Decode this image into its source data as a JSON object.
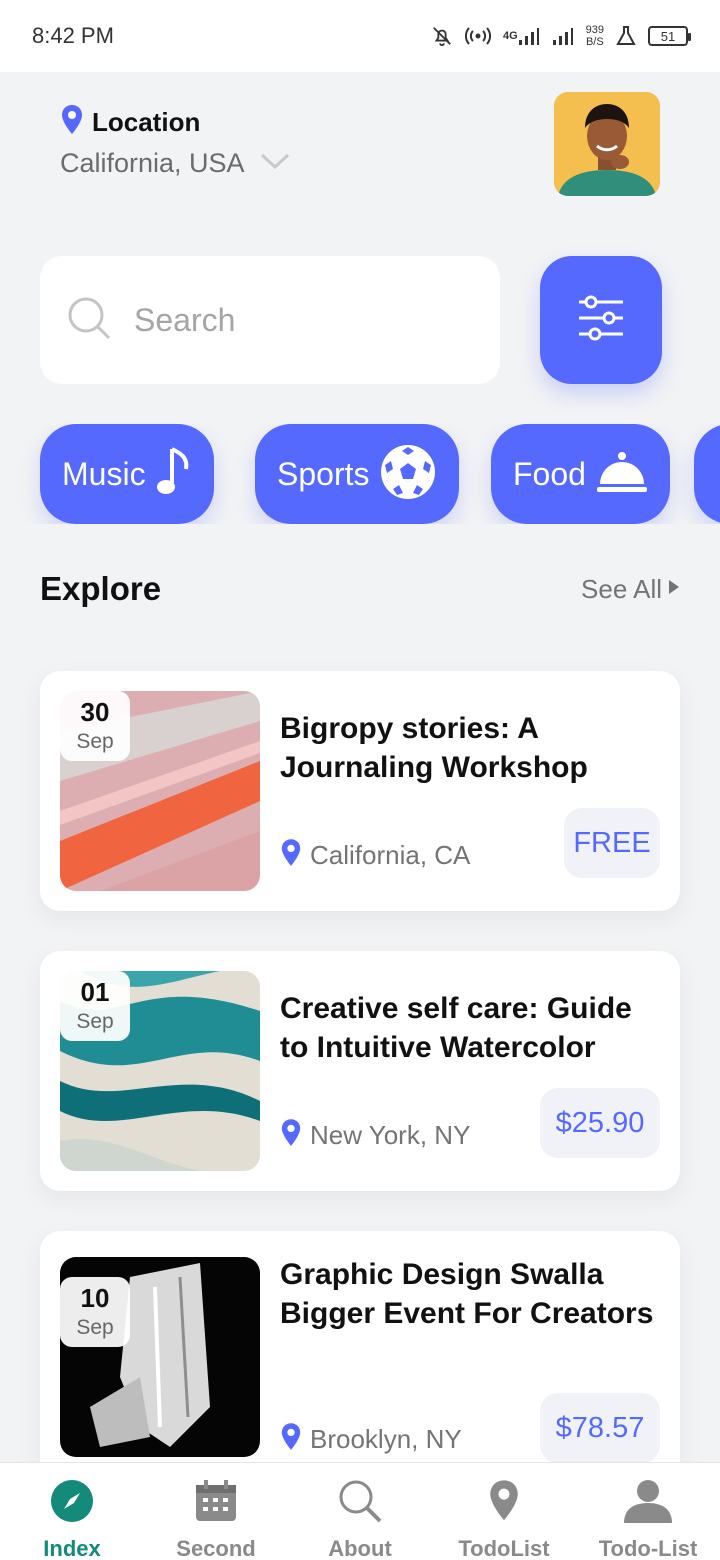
{
  "status_bar": {
    "time": "8:42 PM",
    "signal_label": "4G",
    "netspeed_value": "939",
    "netspeed_unit": "B/S",
    "battery": "51"
  },
  "header": {
    "location_label": "Location",
    "location_value": "California, USA"
  },
  "search": {
    "placeholder": "Search"
  },
  "categories": [
    {
      "label": "Music",
      "icon": "music-note-icon"
    },
    {
      "label": "Sports",
      "icon": "soccer-ball-icon"
    },
    {
      "label": "Food",
      "icon": "food-cloche-icon"
    }
  ],
  "explore": {
    "title": "Explore",
    "see_all": "See All"
  },
  "events": [
    {
      "day": "30",
      "month": "Sep",
      "title": "Bigropy stories: A Journaling Workshop",
      "location": "California, CA",
      "price": "FREE"
    },
    {
      "day": "01",
      "month": "Sep",
      "title": "Creative self care: Guide to Intuitive Watercolor",
      "location": "New York, NY",
      "price": "$25.90"
    },
    {
      "day": "10",
      "month": "Sep",
      "title": "Graphic Design Swalla Bigger Event For Creators",
      "location": "Brooklyn, NY",
      "price": "$78.57"
    }
  ],
  "nav": [
    {
      "label": "Index",
      "icon": "compass-icon",
      "active": true
    },
    {
      "label": "Second",
      "icon": "calendar-icon"
    },
    {
      "label": "About",
      "icon": "search-icon"
    },
    {
      "label": "TodoList",
      "icon": "map-pin-icon"
    },
    {
      "label": "Todo-List",
      "icon": "user-icon"
    }
  ],
  "colors": {
    "accent": "#5669ff",
    "active_nav": "#138a7a",
    "background": "#f2f3f5"
  }
}
